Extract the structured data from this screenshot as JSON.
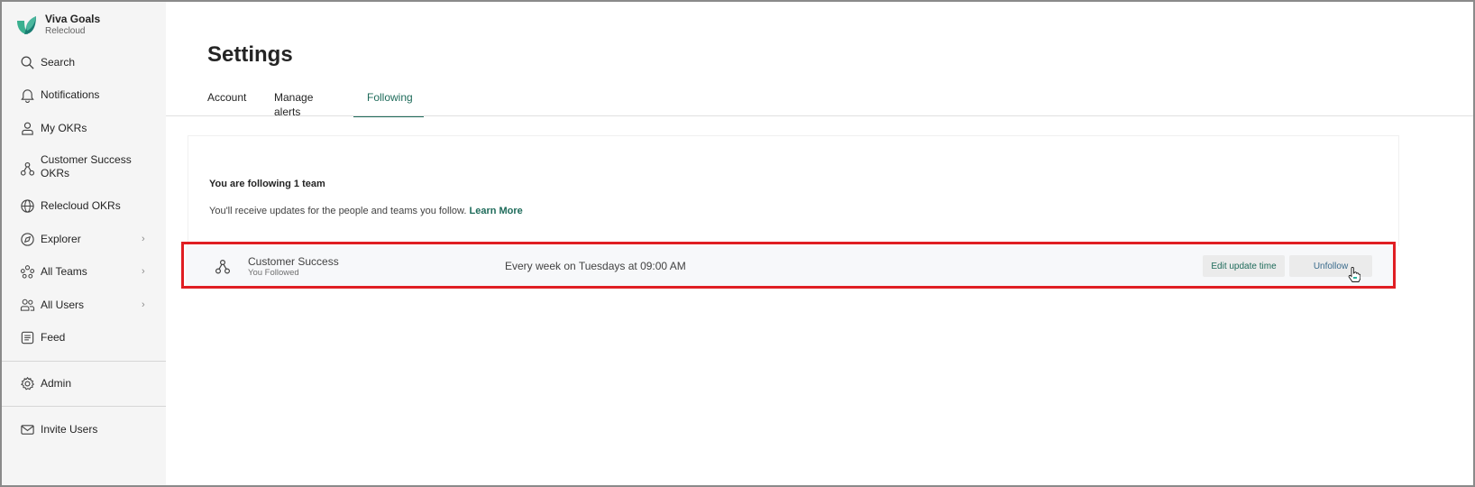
{
  "app": {
    "name": "Viva Goals",
    "org": "Relecloud"
  },
  "sidebar": {
    "items": [
      {
        "label": "Search",
        "icon": "search-icon"
      },
      {
        "label": "Notifications",
        "icon": "bell-icon"
      },
      {
        "label": "My OKRs",
        "icon": "person-icon"
      },
      {
        "label_line1": "Customer Success",
        "label_line2": "OKRs",
        "icon": "team-icon"
      },
      {
        "label": "Relecloud OKRs",
        "icon": "globe-icon"
      },
      {
        "label": "Explorer",
        "icon": "compass-icon",
        "chevron": "›"
      },
      {
        "label": "All Teams",
        "icon": "teams-icon",
        "chevron": "›"
      },
      {
        "label": "All Users",
        "icon": "users-icon",
        "chevron": "›"
      },
      {
        "label": "Feed",
        "icon": "feed-icon"
      },
      {
        "label": "Admin",
        "icon": "gear-icon"
      },
      {
        "label": "Invite Users",
        "icon": "mail-icon"
      }
    ]
  },
  "page": {
    "title": "Settings"
  },
  "tabs": [
    {
      "label": "Account",
      "active": false
    },
    {
      "label": "Manage alerts",
      "active": false
    },
    {
      "label": "Following",
      "active": true
    }
  ],
  "following": {
    "count_text": "You are following 1 team",
    "description": "You'll receive updates for the people and teams you follow.",
    "learn_more": "Learn More",
    "rows": [
      {
        "name": "Customer Success",
        "subtitle": "You Followed",
        "schedule": "Every week on Tuesdays at 09:00 AM",
        "edit_label": "Edit update time",
        "unfollow_label": "Unfollow"
      }
    ]
  },
  "colors": {
    "accent": "#1e6b5a",
    "highlight": "#e01e23",
    "sidebar_bg": "#f5f5f5"
  }
}
